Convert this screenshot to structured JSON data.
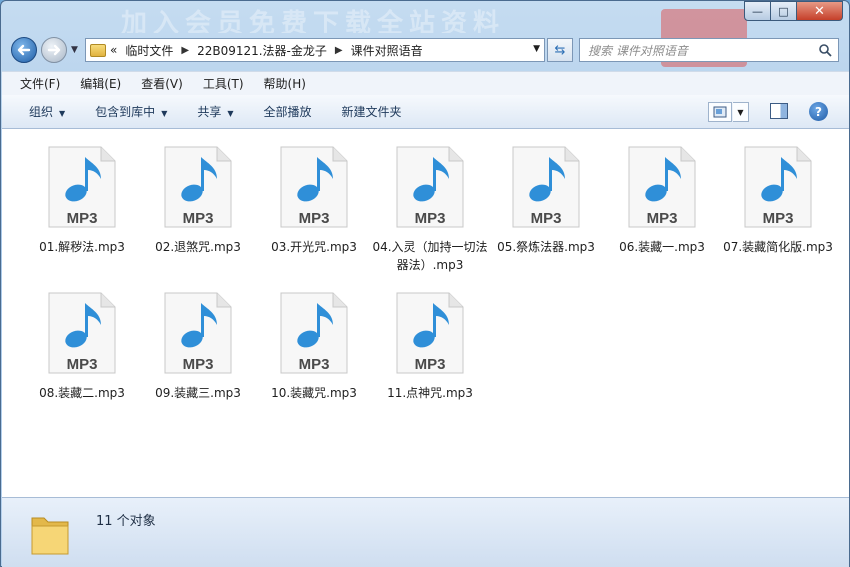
{
  "window": {
    "banner_text": "加入会员免费下载全站资料",
    "minimize_glyph": "—",
    "maximize_glyph": "□",
    "close_glyph": "✕"
  },
  "address": {
    "overflow": "«",
    "crumbs": [
      "临时文件",
      "22B09121.法器-金龙子",
      "课件对照语音"
    ],
    "search_placeholder": "搜索 课件对照语音"
  },
  "menu": [
    "文件(F)",
    "编辑(E)",
    "查看(V)",
    "工具(T)",
    "帮助(H)"
  ],
  "toolbar": {
    "organize": "组织",
    "include_library": "包含到库中",
    "share": "共享",
    "play_all": "全部播放",
    "new_folder": "新建文件夹"
  },
  "files": [
    {
      "name": "01.解秽法.mp3",
      "badge": "MP3"
    },
    {
      "name": "02.退煞咒.mp3",
      "badge": "MP3"
    },
    {
      "name": "03.开光咒.mp3",
      "badge": "MP3"
    },
    {
      "name": "04.入灵（加持一切法器法）.mp3",
      "badge": "MP3"
    },
    {
      "name": "05.祭炼法器.mp3",
      "badge": "MP3"
    },
    {
      "name": "06.装藏一.mp3",
      "badge": "MP3"
    },
    {
      "name": "07.装藏简化版.mp3",
      "badge": "MP3"
    },
    {
      "name": "08.装藏二.mp3",
      "badge": "MP3"
    },
    {
      "name": "09.装藏三.mp3",
      "badge": "MP3"
    },
    {
      "name": "10.装藏咒.mp3",
      "badge": "MP3"
    },
    {
      "name": "11.点神咒.mp3",
      "badge": "MP3"
    }
  ],
  "status": {
    "count_text": "11 个对象"
  },
  "colors": {
    "note": "#2f8fd8",
    "badge_text": "#4a4a4a"
  }
}
